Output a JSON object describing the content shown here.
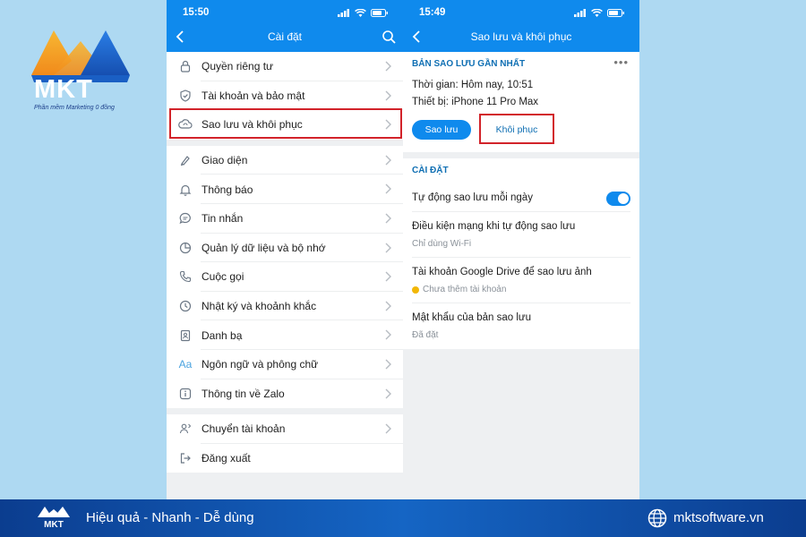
{
  "brand": {
    "logo_text": "MKT",
    "logo_tagline": "Phần mềm Marketing 0 đồng",
    "footer_tagline": "Hiệu quả - Nhanh - Dễ dùng",
    "footer_website": "mktsoftware.vn"
  },
  "settings_screen": {
    "status_time": "15:50",
    "title": "Cài đặt",
    "items_group1": [
      {
        "label": "Quyền riêng tư",
        "icon": "lock-icon"
      },
      {
        "label": "Tài khoản và bảo mật",
        "icon": "shield-icon"
      },
      {
        "label": "Sao lưu và khôi phục",
        "icon": "cloud-sync-icon",
        "highlighted": true
      }
    ],
    "items_group2": [
      {
        "label": "Giao diện",
        "icon": "palette-icon"
      },
      {
        "label": "Thông báo",
        "icon": "bell-icon"
      },
      {
        "label": "Tin nhắn",
        "icon": "chat-icon"
      },
      {
        "label": "Quản lý dữ liệu và bộ nhớ",
        "icon": "pie-chart-icon"
      },
      {
        "label": "Cuộc gọi",
        "icon": "phone-icon"
      },
      {
        "label": "Nhật ký và khoảnh khắc",
        "icon": "clock-icon"
      },
      {
        "label": "Danh bạ",
        "icon": "contacts-icon"
      },
      {
        "label": "Ngôn ngữ và phông chữ",
        "icon": "font-icon"
      },
      {
        "label": "Thông tin về Zalo",
        "icon": "info-icon"
      }
    ],
    "items_group3": [
      {
        "label": "Chuyển tài khoản",
        "icon": "switch-user-icon"
      },
      {
        "label": "Đăng xuất",
        "icon": "logout-icon"
      }
    ]
  },
  "backup_screen": {
    "status_time": "15:49",
    "title": "Sao lưu và khôi phục",
    "latest_header": "BẢN SAO LƯU GẦN NHẤT",
    "time_line": "Thời gian:  Hôm nay, 10:51",
    "device_line": "Thiết bị:  iPhone 11 Pro Max",
    "backup_button": "Sao lưu",
    "restore_button": "Khôi phục",
    "settings_header": "CÀI ĐẶT",
    "auto_backup_label": "Tự động sao lưu mỗi ngày",
    "auto_backup_on": true,
    "network_label": "Điều kiện mạng khi tự động sao lưu",
    "network_value": "Chỉ dùng Wi-Fi",
    "drive_label": "Tài khoản Google Drive để sao lưu ảnh",
    "drive_value": "Chưa thêm tài khoản",
    "password_label": "Mật khẩu của bản sao lưu",
    "password_value": "Đã đặt"
  },
  "colors": {
    "zalo_blue": "#0f8aed",
    "highlight_red": "#d2232a",
    "footer_blue": "#0b3d8f",
    "background": "#aed9f2"
  }
}
